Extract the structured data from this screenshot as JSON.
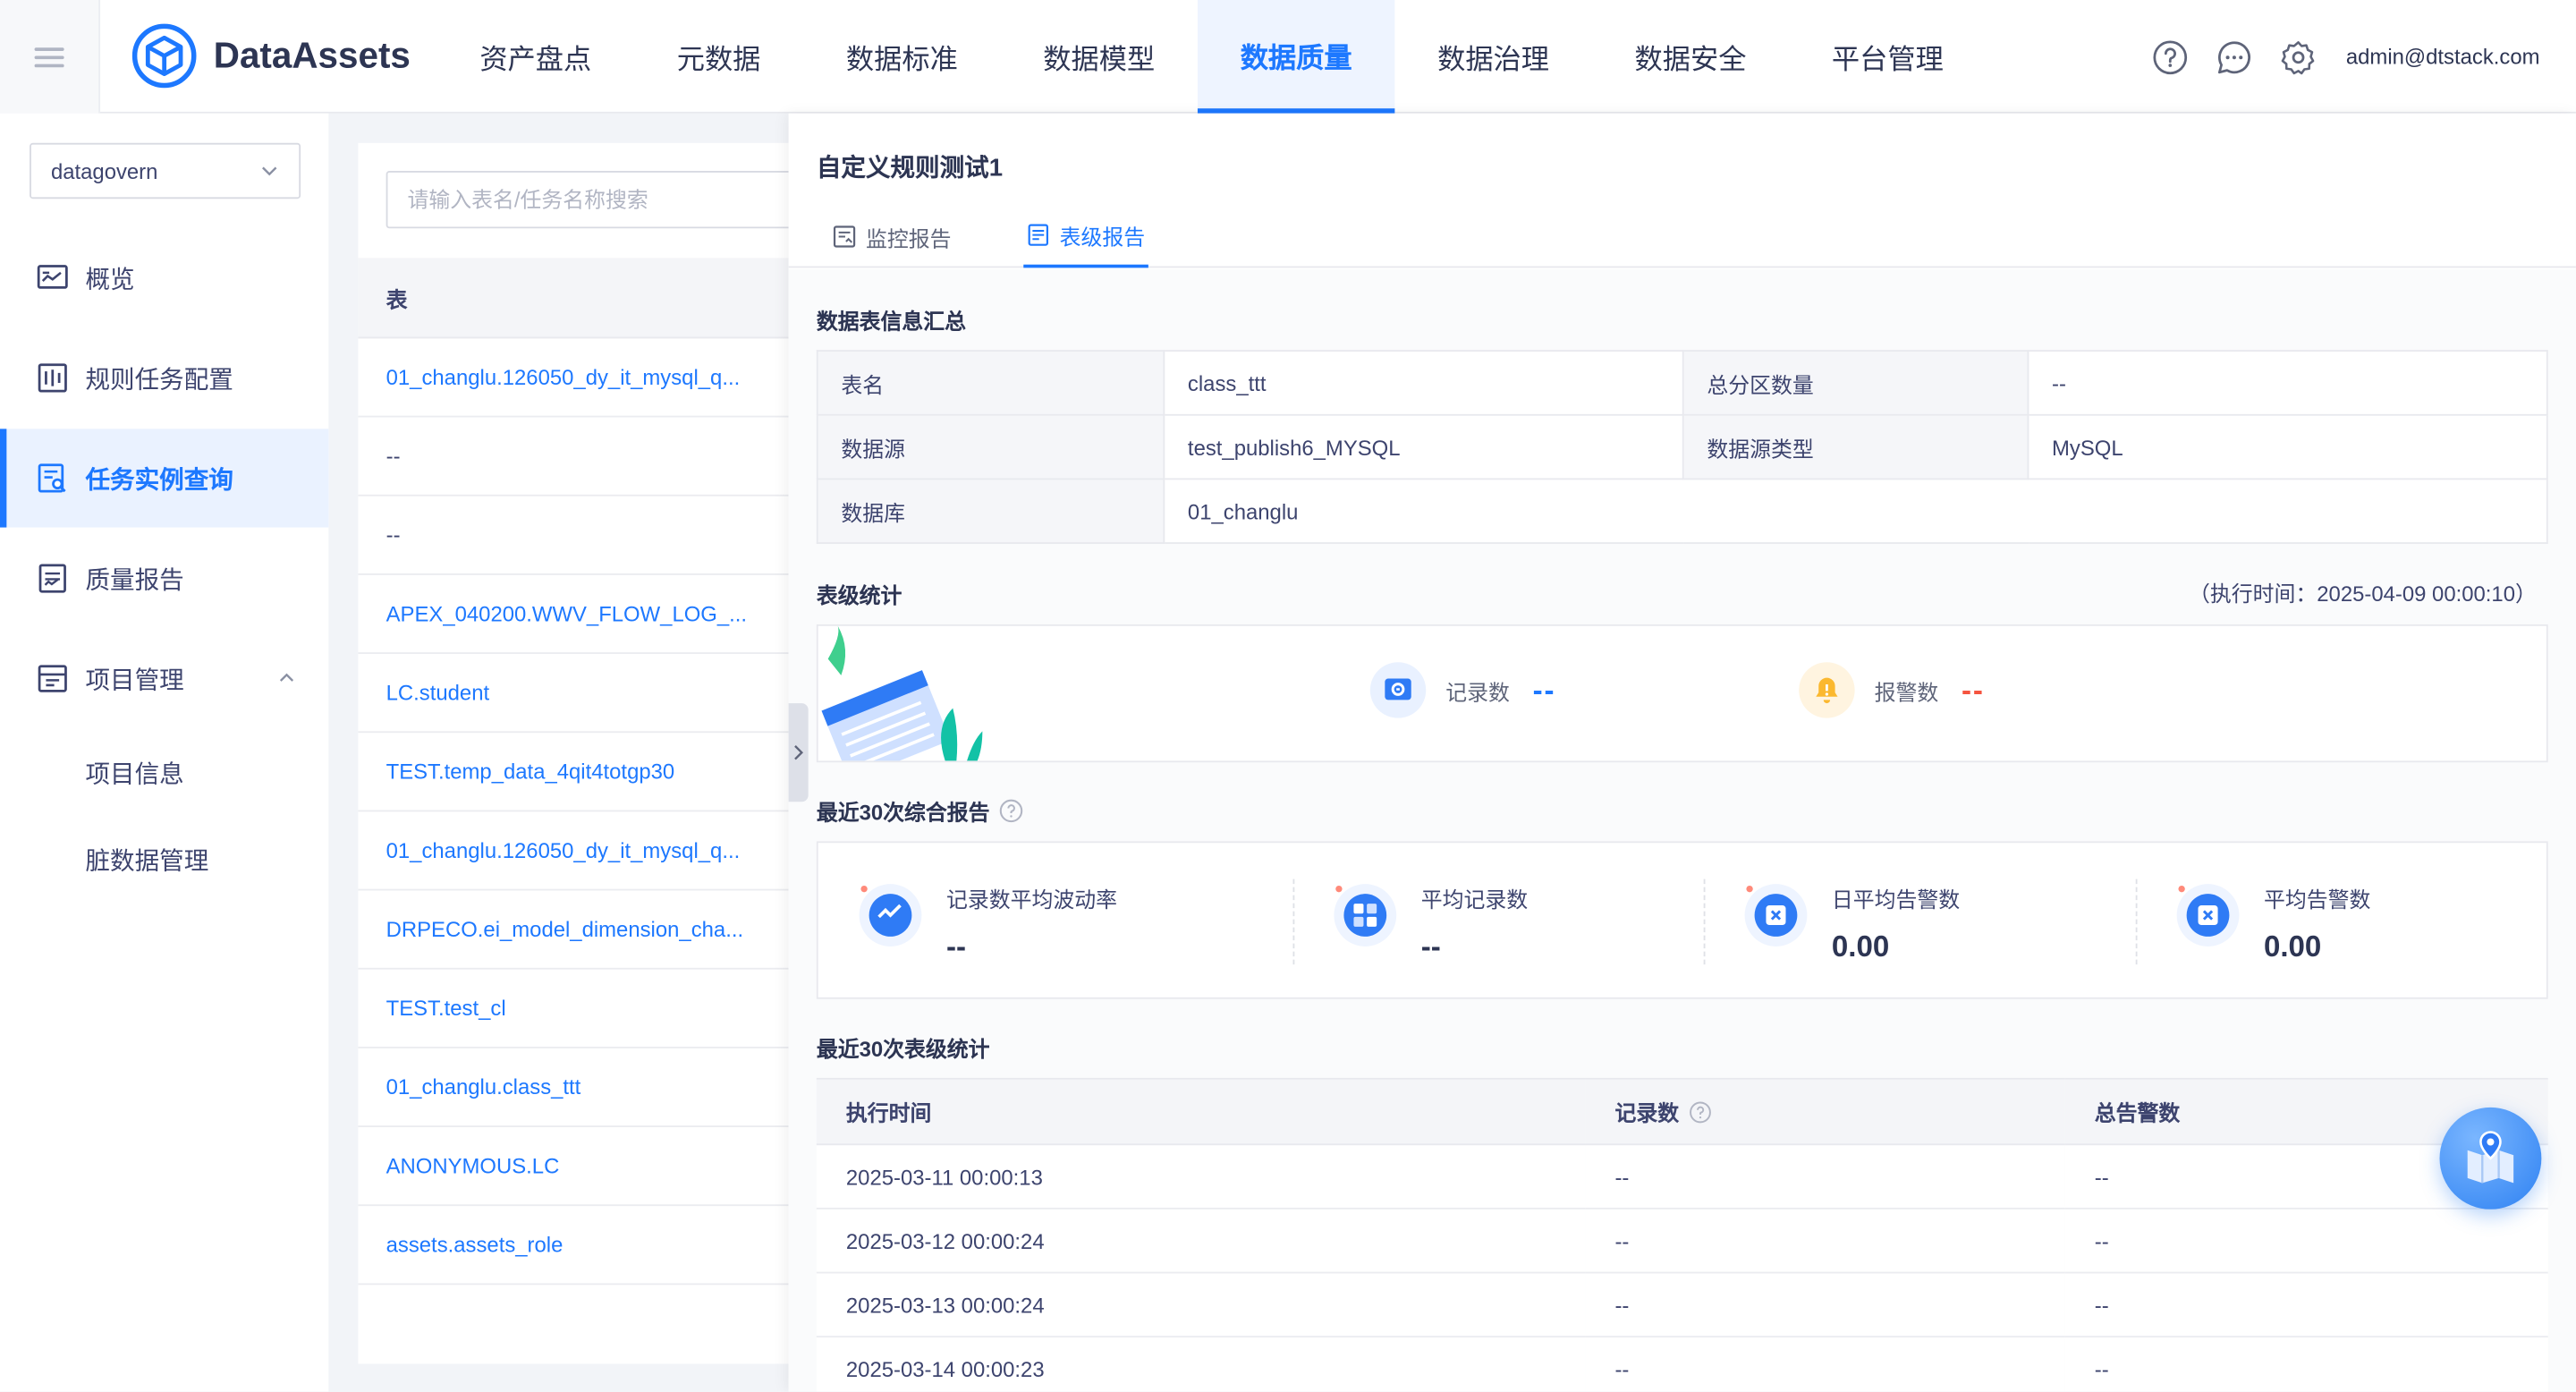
{
  "header": {
    "brand": "DataAssets",
    "nav": [
      "资产盘点",
      "元数据",
      "数据标准",
      "数据模型",
      "数据质量",
      "数据治理",
      "数据安全",
      "平台管理"
    ],
    "active_nav": "数据质量",
    "user": "admin@dtstack.com"
  },
  "sidebar": {
    "project_select": "datagovern",
    "items": [
      {
        "label": "概览",
        "icon": "dashboard-icon"
      },
      {
        "label": "规则任务配置",
        "icon": "rule-config-icon"
      },
      {
        "label": "任务实例查询",
        "icon": "instance-search-icon"
      },
      {
        "label": "质量报告",
        "icon": "report-icon"
      },
      {
        "label": "项目管理",
        "icon": "project-icon"
      }
    ],
    "subitems": [
      "项目信息",
      "脏数据管理"
    ]
  },
  "list": {
    "search_placeholder": "请输入表名/任务名称搜索",
    "column": "表",
    "rows": [
      "01_changlu.126050_dy_it_mysql_q...",
      "--",
      "--",
      "APEX_040200.WWV_FLOW_LOG_...",
      "LC.student",
      "TEST.temp_data_4qit4totgp30",
      "01_changlu.126050_dy_it_mysql_q...",
      "DRPECO.ei_model_dimension_cha...",
      "TEST.test_cl",
      "01_changlu.class_ttt",
      "ANONYMOUS.LC",
      "assets.assets_role"
    ]
  },
  "detail": {
    "title": "自定义规则测试1",
    "tabs": [
      "监控报告",
      "表级报告"
    ],
    "summary_title": "数据表信息汇总",
    "info": {
      "table_name_label": "表名",
      "table_name": "class_ttt",
      "partition_label": "总分区数量",
      "partition": "--",
      "source_label": "数据源",
      "source": "test_publish6_MYSQL",
      "source_type_label": "数据源类型",
      "source_type": "MySQL",
      "db_label": "数据库",
      "db": "01_changlu"
    },
    "stats_title": "表级统计",
    "exec_time": "（执行时间：2025-04-09 00:00:10）",
    "stats": {
      "records_label": "记录数",
      "records": "--",
      "alarms_label": "报警数",
      "alarms": "--"
    },
    "report_title": "最近30次综合报告",
    "report_cards": [
      {
        "label": "记录数平均波动率",
        "value": "--"
      },
      {
        "label": "平均记录数",
        "value": "--"
      },
      {
        "label": "日平均告警数",
        "value": "0.00"
      },
      {
        "label": "平均告警数",
        "value": "0.00"
      }
    ],
    "history_title": "最近30次表级统计",
    "history_columns": [
      "执行时间",
      "记录数",
      "总告警数"
    ],
    "history_rows": [
      [
        "2025-03-11 00:00:13",
        "--",
        "--"
      ],
      [
        "2025-03-12 00:00:24",
        "--",
        "--"
      ],
      [
        "2025-03-13 00:00:24",
        "--",
        "--"
      ],
      [
        "2025-03-14 00:00:23",
        "--",
        "--"
      ]
    ]
  },
  "colors": {
    "accent": "#1d78ff",
    "alarm": "#f5543f",
    "warn": "#fbb82f"
  }
}
